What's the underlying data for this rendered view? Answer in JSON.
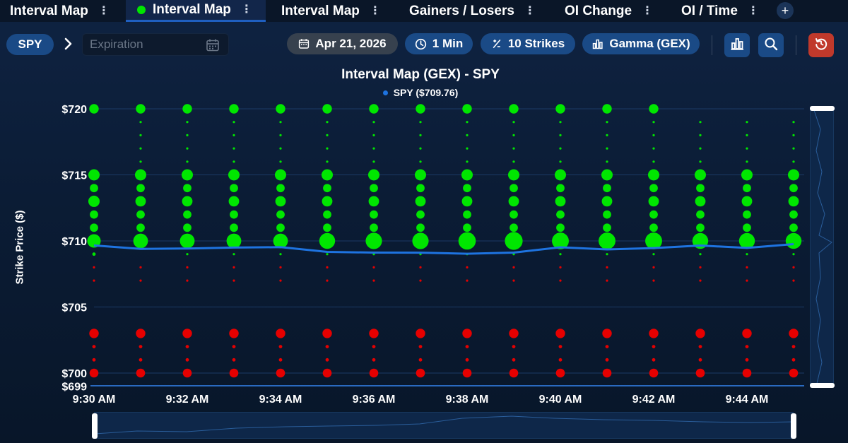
{
  "tabs": [
    {
      "label": "Interval Map",
      "active": false
    },
    {
      "label": "Interval Map",
      "active": true
    },
    {
      "label": "Interval Map",
      "active": false
    },
    {
      "label": "Gainers / Losers",
      "active": false
    },
    {
      "label": "OI Change",
      "active": false
    },
    {
      "label": "OI / Time",
      "active": false
    }
  ],
  "tab_menu_glyph": "⋮",
  "add_tab_glyph": "+",
  "toolbar": {
    "symbol": "SPY",
    "expiration_placeholder": "Expiration",
    "date": "Apr 21, 2026",
    "interval": "1 Min",
    "strikes": "10 Strikes",
    "metric": "Gamma (GEX)"
  },
  "icons": {
    "chevron": "chevron-right-icon",
    "calendar": "calendar-icon",
    "clock": "clock-icon",
    "strikes": "plus-minus-icon",
    "metric": "bar-chart-icon",
    "chart_type": "bar-chart-icon",
    "search": "zoom-icon",
    "reset": "reset-icon"
  },
  "colors": {
    "accent": "#1a4a86",
    "positive": "#00e600",
    "negative": "#e60000",
    "spy_line": "#1e73e0",
    "reset_button": "#c0392b"
  },
  "chart_data": {
    "type": "scatter",
    "title": "Interval Map (GEX) - SPY",
    "legend": [
      {
        "name": "SPY ($709.76)",
        "color": "#1e73e0"
      }
    ],
    "ylabel": "Strike Price ($)",
    "ylim": [
      699,
      720
    ],
    "ytick_labels": [
      "$720",
      "$715",
      "$710",
      "$705",
      "$700",
      "$699"
    ],
    "yticks": [
      720,
      715,
      710,
      705,
      700,
      699
    ],
    "xtick_labels": [
      "9:30 AM",
      "9:32 AM",
      "9:34 AM",
      "9:36 AM",
      "9:38 AM",
      "9:40 AM",
      "9:42 AM",
      "9:44 AM"
    ],
    "x": [
      "9:30",
      "9:31",
      "9:32",
      "9:33",
      "9:34",
      "9:35",
      "9:36",
      "9:37",
      "9:38",
      "9:39",
      "9:40",
      "9:41",
      "9:42",
      "9:43",
      "9:44",
      "9:45"
    ],
    "gridlines": [
      720,
      715,
      710,
      705,
      700
    ],
    "strikes": [
      720,
      719,
      718,
      717,
      716,
      715,
      714,
      713,
      712,
      711,
      710,
      709,
      708,
      707,
      706,
      705,
      704,
      703,
      702,
      701,
      700
    ],
    "gex": [
      [
        3,
        0,
        0,
        0,
        0,
        5,
        2,
        5,
        2,
        2,
        8,
        1,
        -0.5,
        -0.5,
        0,
        0,
        0,
        -3,
        -1,
        -1,
        -2.5
      ],
      [
        3,
        0.5,
        0.5,
        0.5,
        0.5,
        5,
        2,
        4,
        2,
        2,
        10,
        0,
        -0.5,
        -0.5,
        0,
        0,
        0,
        -3,
        -1,
        -1,
        -2.5
      ],
      [
        3,
        0.5,
        0.5,
        0.5,
        0.5,
        5,
        2,
        4,
        2,
        2,
        10,
        0.5,
        -0.5,
        -0.5,
        0,
        0,
        0,
        -3,
        -1,
        -1,
        -2.5
      ],
      [
        3,
        0.5,
        0.5,
        0.5,
        0.5,
        5,
        2,
        4,
        2,
        2,
        10,
        0.5,
        -0.5,
        -0.5,
        0,
        0,
        0,
        -3,
        -1,
        -1,
        -2.5
      ],
      [
        3,
        0.5,
        0.5,
        0.5,
        0.5,
        5,
        2,
        4,
        2,
        2,
        10,
        0.5,
        -0.5,
        -0.5,
        0,
        0,
        0,
        -3,
        -1,
        -1,
        -2.5
      ],
      [
        3,
        0.5,
        0.5,
        0.5,
        0.5,
        5,
        2,
        4,
        2,
        2,
        12,
        0.5,
        -0.5,
        -0.5,
        0,
        0,
        0,
        -3,
        -1,
        -1,
        -2.5
      ],
      [
        3,
        0.5,
        0.5,
        0.5,
        0.5,
        5,
        2,
        4,
        2,
        2,
        13,
        0.5,
        -0.5,
        -0.5,
        0,
        0,
        0,
        -3,
        -1,
        -1,
        -2.5
      ],
      [
        3,
        0.5,
        0.5,
        0.5,
        0.5,
        5,
        2,
        4,
        2,
        2,
        13,
        0.5,
        -0.5,
        -0.5,
        0,
        0,
        0,
        -3,
        -1,
        -1,
        -2.5
      ],
      [
        3,
        0.5,
        0.5,
        0.5,
        0.5,
        5,
        2,
        4,
        2,
        2,
        15,
        0.5,
        -0.5,
        -0.5,
        0,
        0,
        0,
        -3,
        -1,
        -1,
        -2.5
      ],
      [
        3,
        0.5,
        0.5,
        0.5,
        0.5,
        5,
        2,
        4,
        2,
        2,
        16,
        0.5,
        -0.5,
        -0.5,
        0,
        0,
        0,
        -3,
        -1,
        -1,
        -2.5
      ],
      [
        3,
        0.5,
        0.5,
        0.5,
        0.5,
        5,
        2,
        4,
        2,
        2,
        14,
        0.5,
        -0.5,
        -0.5,
        0,
        0,
        0,
        -3,
        -1,
        -1,
        -2.5
      ],
      [
        3,
        0.5,
        0.5,
        0.5,
        0.5,
        5,
        2,
        4,
        2,
        2,
        14,
        0.5,
        -0.5,
        -0.5,
        0,
        0,
        0,
        -3,
        -1,
        -1,
        -2.5
      ],
      [
        3,
        0.5,
        0.5,
        0.5,
        0.5,
        5,
        2,
        4,
        2,
        2,
        14,
        0.5,
        -0.5,
        -0.5,
        0,
        0,
        0,
        -3,
        -1,
        -1,
        -2.5
      ],
      [
        0,
        0.5,
        0.5,
        0.5,
        0.5,
        5,
        2,
        4,
        2,
        2,
        12,
        0.5,
        -0.5,
        -0.5,
        0,
        0,
        0,
        -3,
        -1,
        -1,
        -2.5
      ],
      [
        0,
        0.5,
        0.5,
        0.5,
        0.5,
        5,
        2,
        4,
        2,
        2,
        12,
        0.5,
        -0.5,
        -0.5,
        0,
        0,
        0,
        -3,
        -1,
        -1,
        -2.5
      ],
      [
        0,
        0.5,
        0.5,
        0.5,
        0.5,
        5,
        2,
        4,
        2,
        2,
        12,
        0.5,
        -0.5,
        -0.5,
        0,
        0,
        0,
        -3,
        -1,
        -1,
        -2.5
      ]
    ],
    "spy_price": [
      709.66,
      709.4,
      709.43,
      709.5,
      709.53,
      709.17,
      709.12,
      709.11,
      709.03,
      709.12,
      709.52,
      709.36,
      709.46,
      709.65,
      709.47,
      709.76
    ],
    "grid": true,
    "legend_position": "top"
  }
}
